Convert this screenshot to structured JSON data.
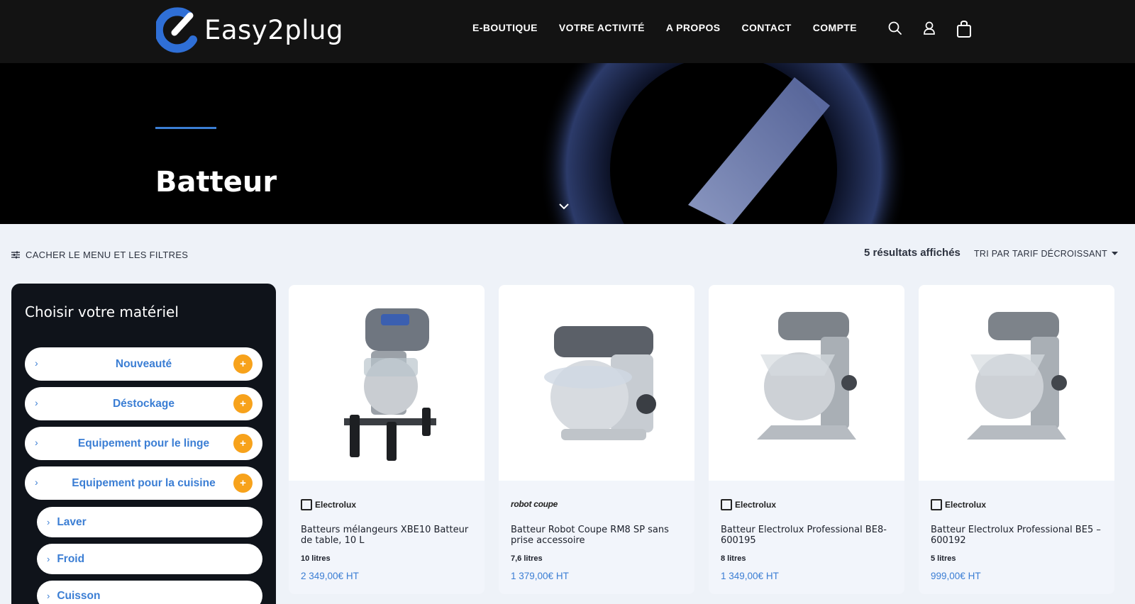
{
  "brand": {
    "name": "Easy2plug",
    "accent": "#3b7ed4"
  },
  "nav": {
    "items": [
      "E-BOUTIQUE",
      "VOTRE ACTIVITÉ",
      "A PROPOS",
      "CONTACT",
      "COMPTE"
    ]
  },
  "icons": [
    "search-icon",
    "user-icon",
    "shopping-bag-icon"
  ],
  "hero": {
    "title": "Batteur"
  },
  "toolbar": {
    "filter_toggle": "CACHER LE MENU ET LES FILTRES",
    "results": "5 résultats affichés",
    "sort": "TRI PAR TARIF DÉCROISSANT"
  },
  "sidebar": {
    "title": "Choisir votre matériel",
    "categories": [
      {
        "label": "Nouveauté"
      },
      {
        "label": "Déstockage"
      },
      {
        "label": "Equipement pour le linge"
      },
      {
        "label": "Equipement pour la cuisine"
      }
    ],
    "subcategories": [
      {
        "label": "Laver"
      },
      {
        "label": "Froid"
      },
      {
        "label": "Cuisson"
      }
    ]
  },
  "products": [
    {
      "brand": "Electrolux",
      "name": "Batteurs mélangeurs XBE10 Batteur de table, 10 L",
      "capacity": "10 litres",
      "price": "2 349,00€",
      "unit": "HT"
    },
    {
      "brand": "robot coupe",
      "name": "Batteur Robot Coupe RM8 SP sans prise accessoire",
      "capacity": "7,6 litres",
      "price": "1 379,00€",
      "unit": "HT"
    },
    {
      "brand": "Electrolux",
      "name": "Batteur Electrolux Professional BE8- 600195",
      "capacity": "8 litres",
      "price": "1 349,00€",
      "unit": "HT"
    },
    {
      "brand": "Electrolux",
      "name": "Batteur Electrolux Professional BE5 – 600192",
      "capacity": "5 litres",
      "price": "999,00€",
      "unit": "HT"
    }
  ],
  "colors": {
    "accent_blue": "#3b7ed4",
    "orange": "#f7a21b",
    "dark": "#131313"
  }
}
